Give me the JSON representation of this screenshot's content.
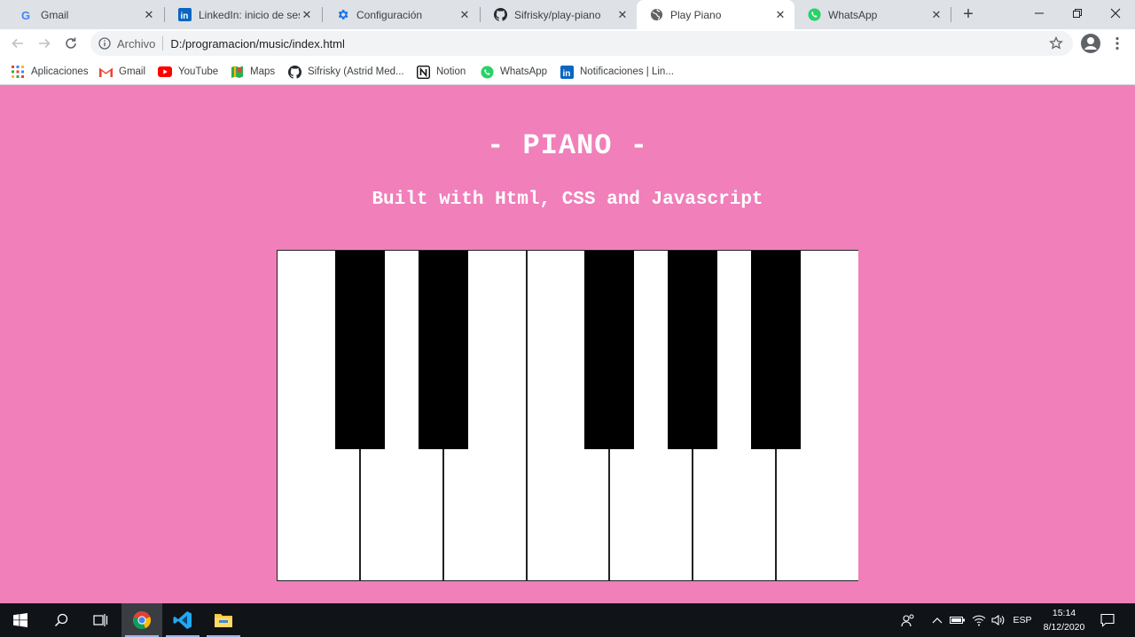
{
  "browser": {
    "tabs": [
      {
        "title": "Gmail",
        "icon": "google-icon",
        "active": false
      },
      {
        "title": "LinkedIn: inicio de sesión",
        "icon": "linkedin-icon",
        "active": false
      },
      {
        "title": "Configuración",
        "icon": "gear-icon",
        "active": false
      },
      {
        "title": "Sifrisky/play-piano",
        "icon": "github-icon",
        "active": false
      },
      {
        "title": "Play Piano",
        "icon": "globe-icon",
        "active": true
      },
      {
        "title": "WhatsApp",
        "icon": "whatsapp-icon",
        "active": false
      }
    ],
    "address": {
      "scheme_label": "Archivo",
      "url": "D:/programacion/music/index.html"
    },
    "bookmarks": [
      {
        "label": "Aplicaciones",
        "icon": "apps-grid-icon"
      },
      {
        "label": "Gmail",
        "icon": "gmail-icon"
      },
      {
        "label": "YouTube",
        "icon": "youtube-icon"
      },
      {
        "label": "Maps",
        "icon": "maps-icon"
      },
      {
        "label": "Sifrisky (Astrid Med...",
        "icon": "github-icon"
      },
      {
        "label": "Notion",
        "icon": "notion-icon"
      },
      {
        "label": "WhatsApp",
        "icon": "whatsapp-icon"
      },
      {
        "label": "Notificaciones | Lin...",
        "icon": "linkedin-icon"
      }
    ]
  },
  "page": {
    "title": "- PIANO -",
    "subtitle": "Built with Html, CSS and Javascript",
    "background_color": "#f07fba",
    "piano": {
      "white_keys": 7,
      "black_keys": 5
    }
  },
  "taskbar": {
    "apps": [
      "windows-start-icon",
      "search-icon",
      "task-view-icon",
      "chrome-icon",
      "vscode-icon",
      "file-explorer-icon"
    ],
    "tray": {
      "language": "ESP",
      "time": "15:14",
      "date": "8/12/2020"
    }
  },
  "colors": {
    "tabstrip": "#dee1e6",
    "page_background": "#f07fba",
    "key_white": "#ffffff",
    "key_black": "#000000",
    "taskbar": "#101418"
  }
}
